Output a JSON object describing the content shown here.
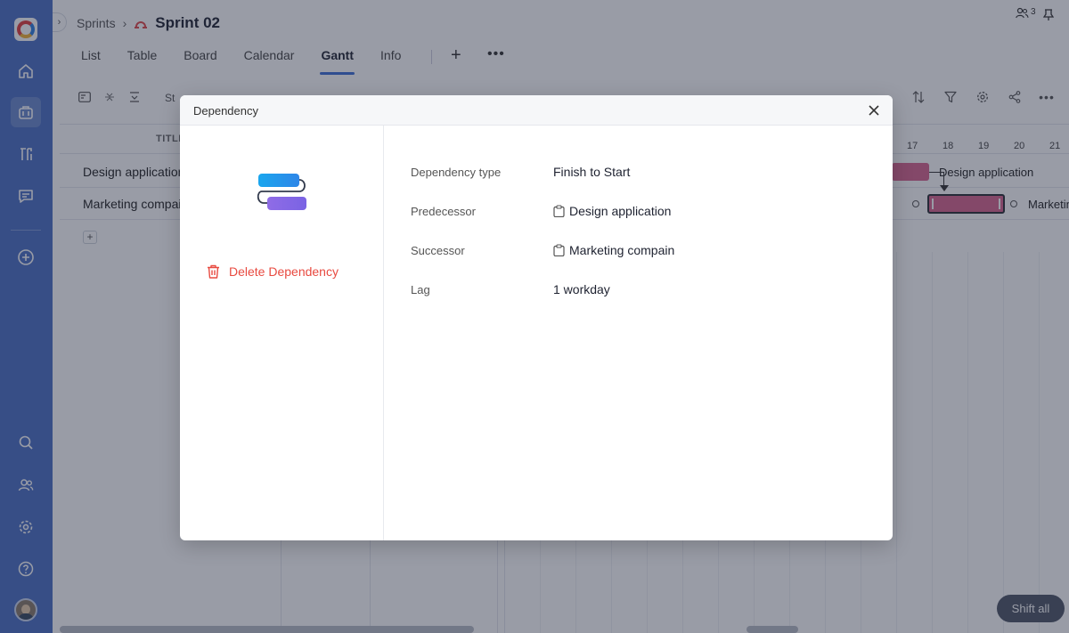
{
  "header": {
    "breadcrumb_parent": "Sprints",
    "title": "Sprint 02",
    "members_count": "3"
  },
  "tabs": [
    {
      "label": "List"
    },
    {
      "label": "Table"
    },
    {
      "label": "Board"
    },
    {
      "label": "Calendar"
    },
    {
      "label": "Gantt",
      "active": true
    },
    {
      "label": "Info"
    }
  ],
  "toolbar": {
    "partial_label": "St"
  },
  "gantt": {
    "column_title": "TITLE",
    "days": [
      "17",
      "18",
      "19",
      "20",
      "21"
    ],
    "rows": [
      {
        "title": "Design application"
      },
      {
        "title": "Marketing compain"
      }
    ],
    "bar_labels": [
      "Design application",
      "Marketing compain"
    ]
  },
  "shift_all_label": "Shift all",
  "modal": {
    "title": "Dependency",
    "delete_label": "Delete Dependency",
    "fields": [
      {
        "label": "Dependency type",
        "value": "Finish to Start"
      },
      {
        "label": "Predecessor",
        "value": "Design application"
      },
      {
        "label": "Successor",
        "value": "Marketing compain"
      },
      {
        "label": "Lag",
        "value": "1 workday"
      }
    ]
  },
  "colors": {
    "rail": "#4a6fc4",
    "accent": "#3d6fd6",
    "bar": "#d9648f",
    "danger": "#e84a40"
  }
}
